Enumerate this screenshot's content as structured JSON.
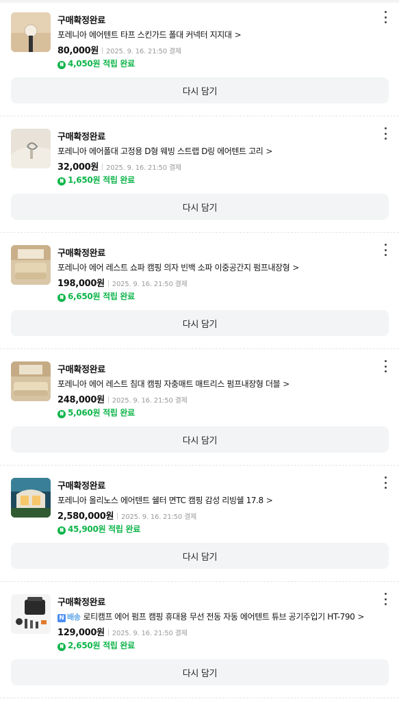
{
  "theme": {
    "accent_green": "#0eb54a",
    "button_bg": "#f2f4f5",
    "delivery_blue": "#4d8ff2"
  },
  "orders": [
    {
      "status": "구매확정완료",
      "product_name": "포레니아 에어텐트 타프 스킨가드 폴대 커넥터 지지대",
      "price": "80,000원",
      "date": "2025. 9. 16. 21:50 결제",
      "points": "4,050원 적립 완료",
      "rebuy_label": "다시 담기",
      "thumb_icon": "tent-pole-connector-image"
    },
    {
      "status": "구매확정완료",
      "product_name": "포레니아 에어폴대 고정용 D형 웨빙 스트랩 D링 에어텐트 고리",
      "price": "32,000원",
      "date": "2025. 9. 16. 21:50 결제",
      "points": "1,650원 적립 완료",
      "rebuy_label": "다시 담기",
      "thumb_icon": "d-ring-strap-image"
    },
    {
      "status": "구매확정완료",
      "product_name": "포레니아 에어 레스트 쇼파 캠핑 의자 빈백 소파 이중공간지 펌프내장형",
      "price": "198,000원",
      "date": "2025. 9. 16. 21:50 결제",
      "points": "6,650원 적립 완료",
      "rebuy_label": "다시 담기",
      "thumb_icon": "air-sofa-image"
    },
    {
      "status": "구매확정완료",
      "product_name": "포레니아 에어 레스트 침대 캠핑 자충매트 매트리스 펌프내장형 더블",
      "price": "248,000원",
      "date": "2025. 9. 16. 21:50 결제",
      "points": "5,060원 적립 완료",
      "rebuy_label": "다시 담기",
      "thumb_icon": "air-mattress-image"
    },
    {
      "status": "구매확정완료",
      "product_name": "포레니아 올리노스 에어텐트 쉘터 면TC 캠핑 감성 리빙쉘 17.8",
      "price": "2,580,000원",
      "date": "2025. 9. 16. 21:50 결제",
      "points": "45,900원 적립 완료",
      "rebuy_label": "다시 담기",
      "thumb_icon": "air-tent-shelter-image"
    },
    {
      "status": "구매확정완료",
      "delivery_badge": "배송",
      "delivery_badge_letter": "N",
      "product_name": "로티캠프 에어 펌프 캠핑 휴대용 무선 전동 자동 에어텐트 튜브 공기주입기 HT-790",
      "price": "129,000원",
      "date": "2025. 9. 16. 21:50 결제",
      "points": "2,650원 적립 완료",
      "rebuy_label": "다시 담기",
      "thumb_icon": "air-pump-image"
    }
  ],
  "chevron": ">",
  "point_icon_glyph": "₦"
}
